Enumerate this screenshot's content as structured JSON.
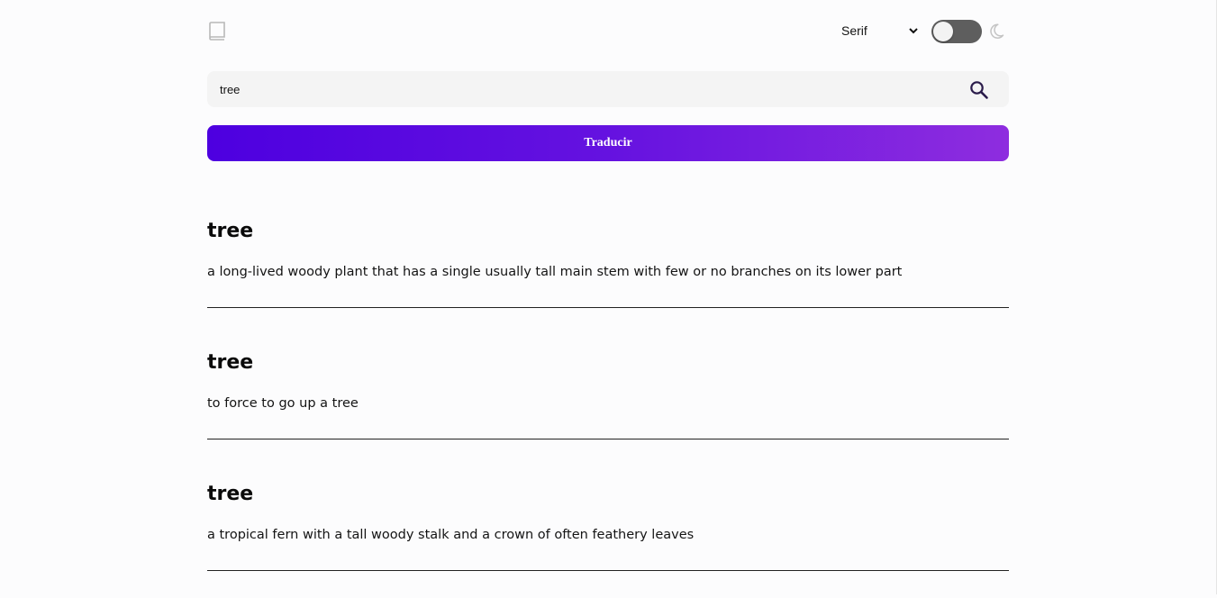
{
  "header": {
    "logo_icon": "book-icon",
    "font_select": {
      "selected": "Serif",
      "options": [
        "Serif"
      ]
    },
    "theme_toggle": {
      "on": false
    },
    "moon_icon": "moon-icon"
  },
  "search": {
    "value": "tree",
    "placeholder": "",
    "icon": "search-icon"
  },
  "translate_button": {
    "label": "Traducir",
    "gradient_start": "#4d00e0",
    "gradient_end": "#8e2ddf"
  },
  "results": [
    {
      "word": "tree",
      "definition": "a long-lived woody plant that has a single usually tall main stem with few or no branches on its lower part"
    },
    {
      "word": "tree",
      "definition": "to force to go up a tree"
    },
    {
      "word": "tree",
      "definition": "a tropical fern with a tall woody stalk and a crown of often feathery leaves"
    }
  ]
}
